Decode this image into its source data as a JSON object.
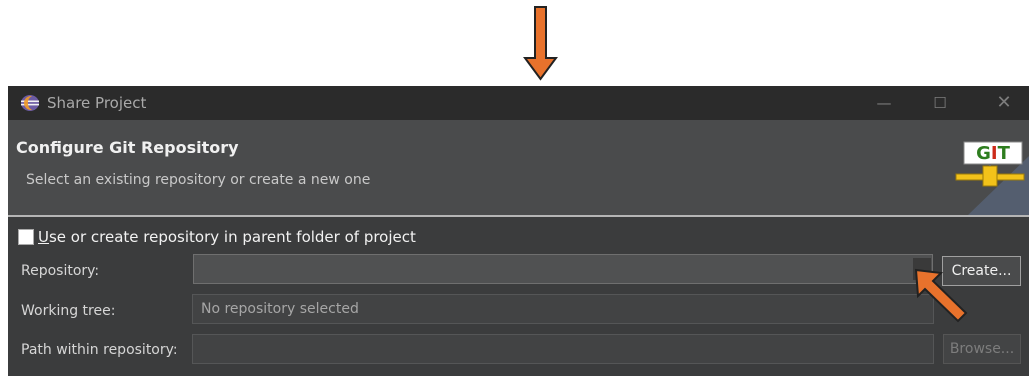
{
  "window": {
    "title": "Share Project",
    "controls": {
      "minimize": "—",
      "maximize": "☐",
      "close": "✕"
    }
  },
  "banner": {
    "heading": "Configure Git Repository",
    "subheading": "Select an existing repository or create a new one",
    "logo_text": "GIT"
  },
  "form": {
    "use_parent_checkbox": {
      "checked": false,
      "label_mnemonic": "U",
      "label_rest": "se or create repository in parent folder of project"
    },
    "repository_label": "Repository:",
    "repository_value": "",
    "create_button": "Create...",
    "working_tree_label": "Working tree:",
    "working_tree_value": "No repository selected",
    "path_label": "Path within repository:",
    "path_value": "",
    "browse_button": "Browse..."
  },
  "colors": {
    "annotation_arrow": "#e8722c",
    "titlebar": "#2b2b2b",
    "banner": "#4a4b4c",
    "body": "#3b3c3d",
    "git_logo_green": "#2e7d1f",
    "git_logo_red": "#cc2a1a",
    "git_logo_gold": "#f2c21a"
  },
  "icons": {
    "app": "eclipse-icon",
    "combo": "chevron-down-icon",
    "annotations": [
      "down-arrow-annotation",
      "pointer-arrow-annotation"
    ]
  }
}
